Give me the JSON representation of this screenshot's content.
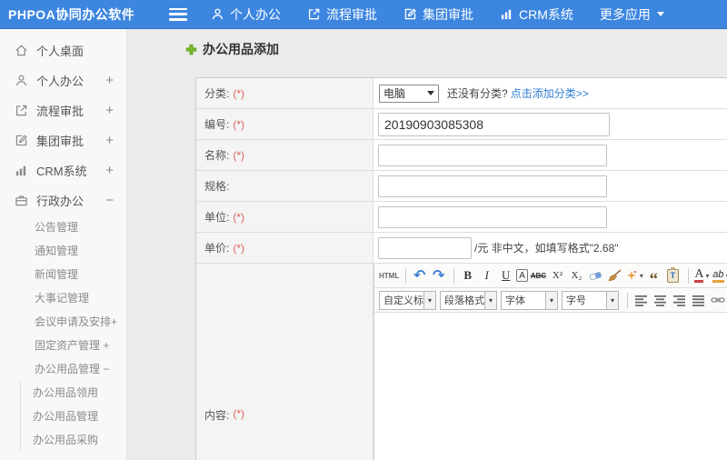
{
  "topbar": {
    "brand": "PHPOA协同办公软件",
    "nav": [
      {
        "label": "个人办公",
        "icon": "user-icon"
      },
      {
        "label": "流程审批",
        "icon": "share-icon"
      },
      {
        "label": "集团审批",
        "icon": "edit-icon"
      },
      {
        "label": "CRM系统",
        "icon": "chart-icon"
      },
      {
        "label": "更多应用",
        "icon": "chevron-down-icon"
      }
    ]
  },
  "sidebar": {
    "items": [
      {
        "label": "个人桌面",
        "icon": "home-icon",
        "expand": ""
      },
      {
        "label": "个人办公",
        "icon": "user-icon",
        "expand": "+"
      },
      {
        "label": "流程审批",
        "icon": "share-icon",
        "expand": "+"
      },
      {
        "label": "集团审批",
        "icon": "edit-icon",
        "expand": "+"
      },
      {
        "label": "CRM系统",
        "icon": "chart-icon",
        "expand": "+"
      },
      {
        "label": "行政办公",
        "icon": "briefcase-icon",
        "expand": "−"
      }
    ],
    "subitems": [
      {
        "label": "公告管理"
      },
      {
        "label": "通知管理"
      },
      {
        "label": "新闻管理"
      },
      {
        "label": "大事记管理"
      },
      {
        "label": "会议申请及安排+"
      },
      {
        "label": "固定资产管理 +"
      },
      {
        "label": "办公用品管理 −"
      }
    ],
    "subsubitems": [
      {
        "label": "办公用品领用"
      },
      {
        "label": "办公用品管理"
      },
      {
        "label": "办公用品采购"
      }
    ]
  },
  "page": {
    "title": "办公用品添加"
  },
  "form": {
    "rows": {
      "category": {
        "label": "分类:",
        "required": "(*)"
      },
      "code": {
        "label": "编号:",
        "required": "(*)",
        "value": "20190903085308"
      },
      "name": {
        "label": "名称:",
        "required": "(*)"
      },
      "spec": {
        "label": "规格:",
        "required": ""
      },
      "unit": {
        "label": "单位:",
        "required": "(*)"
      },
      "price": {
        "label": "单价:",
        "required": "(*)",
        "hint": "/元 非中文，如填写格式\"2.68\""
      },
      "content": {
        "label": "内容:",
        "required": "(*)"
      }
    },
    "category": {
      "selected": "电脑",
      "hint": "还没有分类?",
      "link": "点击添加分类>>"
    }
  },
  "editor": {
    "buttons": {
      "html": "HTML",
      "undo": "↶",
      "redo": "↷",
      "bold": "B",
      "italic": "I",
      "underline": "U",
      "fontborder": "A",
      "strikethrough": "ABC",
      "superscript": "X²",
      "subscript": "X₂",
      "quote": "“",
      "pastetext": "T",
      "fontcolor": "A",
      "bgcolor": "ab"
    },
    "dropdowns": [
      {
        "label": "自定义标题"
      },
      {
        "label": "段落格式"
      },
      {
        "label": "字体"
      },
      {
        "label": "字号"
      }
    ]
  },
  "colors": {
    "accent": "#3d86e0",
    "link": "#2d7dd2",
    "required": "#e0605a",
    "add_green": "#76b82a"
  }
}
